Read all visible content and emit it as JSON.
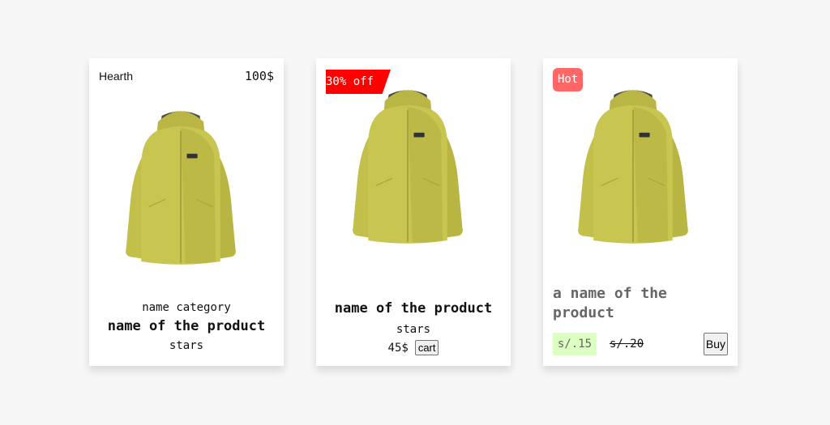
{
  "cards": [
    {
      "brand": "Hearth",
      "price": "100$",
      "category": "name category",
      "name": "name of the product",
      "stars": "stars",
      "image": "yellow-jacket-image"
    },
    {
      "discount_ribbon": "30% off",
      "name": "name of the product",
      "stars": "stars",
      "price": "45$",
      "cart_label": "cart",
      "image": "yellow-jacket-image"
    },
    {
      "badge": "Hot",
      "name": "a name of the product",
      "price_new": "s/.15",
      "price_old": "s/.20",
      "buy_label": "Buy",
      "image": "yellow-jacket-image"
    }
  ],
  "colors": {
    "page_bg": "#f6f6f6",
    "card_bg": "#ffffff",
    "jacket": "#c8c550",
    "discount_ribbon": "#ff0000",
    "hot_badge": "#ff6767",
    "new_price_bg": "#dcffc2"
  }
}
